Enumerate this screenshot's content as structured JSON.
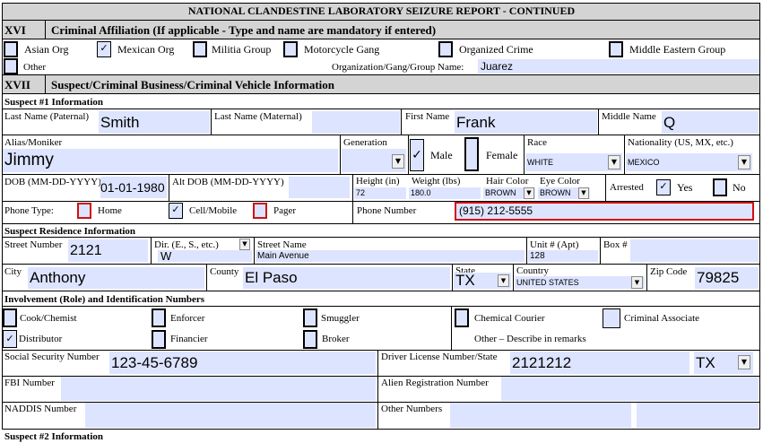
{
  "page_title": "NATIONAL CLANDESTINE LABORATORY SEIZURE REPORT - CONTINUED",
  "section16": {
    "number": "XVI",
    "title": "Criminal Affiliation (If applicable - Type and name are mandatory if entered)",
    "options": [
      {
        "label": "Asian Org",
        "checked": false
      },
      {
        "label": "Mexican Org",
        "checked": true
      },
      {
        "label": "Militia Group",
        "checked": false
      },
      {
        "label": "Motorcycle Gang",
        "checked": false
      },
      {
        "label": "Organized Crime",
        "checked": false
      },
      {
        "label": "Middle Eastern Group",
        "checked": false
      },
      {
        "label": "Other",
        "checked": false
      }
    ],
    "org_name_label": "Organization/Gang/Group Name:",
    "org_name_value": "Juarez"
  },
  "section17": {
    "number": "XVII",
    "title": "Suspect/Criminal Business/Criminal Vehicle Information"
  },
  "suspect1": {
    "heading": "Suspect #1 Information",
    "last_name_paternal_label": "Last Name (Paternal)",
    "last_name_paternal": "Smith",
    "last_name_maternal_label": "Last Name (Maternal)",
    "last_name_maternal": "",
    "first_name_label": "First Name",
    "first_name": "Frank",
    "middle_name_label": "Middle Name",
    "middle_name": "Q",
    "alias_label": "Alias/Moniker",
    "alias": "Jimmy",
    "generation_label": "Generation",
    "generation": "",
    "male_label": "Male",
    "male_checked": true,
    "female_label": "Female",
    "female_checked": false,
    "race_label": "Race",
    "race": "WHITE",
    "nationality_label": "Nationality (US, MX, etc.)",
    "nationality": "MEXICO",
    "dob_label": "DOB (MM-DD-YYYY)",
    "dob": "01-01-1980",
    "alt_dob_label": "Alt DOB (MM-DD-YYYY)",
    "alt_dob": "",
    "height_label": "Height (in)",
    "height": "72",
    "weight_label": "Weight (lbs)",
    "weight": "180.0",
    "hair_label": "Hair Color",
    "hair": "BROWN",
    "eye_label": "Eye Color",
    "eye": "BROWN",
    "arrested_label": "Arrested",
    "yes_label": "Yes",
    "yes_checked": true,
    "no_label": "No",
    "no_checked": false,
    "phone_type_label": "Phone Type:",
    "home_label": "Home",
    "home_checked": false,
    "cell_label": "Cell/Mobile",
    "cell_checked": true,
    "pager_label": "Pager",
    "pager_checked": false,
    "phone_number_label": "Phone Number",
    "phone_number": "(915) 212-5555"
  },
  "residence": {
    "heading": "Suspect Residence Information",
    "street_number_label": "Street Number",
    "street_number": "2121",
    "dir_label": "Dir. (E., S., etc.)",
    "dir": "W",
    "street_name_label": "Street Name",
    "street_name": "Main Avenue",
    "unit_label": "Unit # (Apt)",
    "unit": "128",
    "box_label": "Box #",
    "box": "",
    "city_label": "City",
    "city": "Anthony",
    "county_label": "County",
    "county": "El Paso",
    "state_label": "State",
    "state": "TX",
    "country_label": "Country",
    "country": "UNITED STATES",
    "zip_label": "Zip Code",
    "zip": "79825"
  },
  "involvement": {
    "heading": "Involvement (Role) and Identification Numbers",
    "roles": [
      {
        "label": "Cook/Chemist",
        "checked": false
      },
      {
        "label": "Enforcer",
        "checked": false
      },
      {
        "label": "Smuggler",
        "checked": false
      },
      {
        "label": "Chemical Courier",
        "checked": false
      },
      {
        "label": "Criminal Associate",
        "checked": false
      },
      {
        "label": "Distributor",
        "checked": true
      },
      {
        "label": "Financier",
        "checked": false
      },
      {
        "label": "Broker",
        "checked": false
      }
    ],
    "other_label": "Other – Describe in remarks",
    "ssn_label": "Social Security Number",
    "ssn": "123-45-6789",
    "dl_label": "Driver License Number/State",
    "dl": "2121212",
    "dl_state": "TX",
    "fbi_label": "FBI Number",
    "fbi": "",
    "alien_label": "Alien Registration Number",
    "alien": "",
    "naddis_label": "NADDIS Number",
    "naddis": "",
    "other_numbers_label": "Other Numbers",
    "other_numbers": ""
  },
  "suspect2_heading_partial": "Suspect #2 Information",
  "colors": {
    "field_fill": "#dde4ff",
    "section_gray": "#d4d4d4",
    "phone_highlight": "#d01010"
  },
  "icons": {
    "check": "check-icon",
    "dropdown": "dropdown-arrow-icon"
  }
}
